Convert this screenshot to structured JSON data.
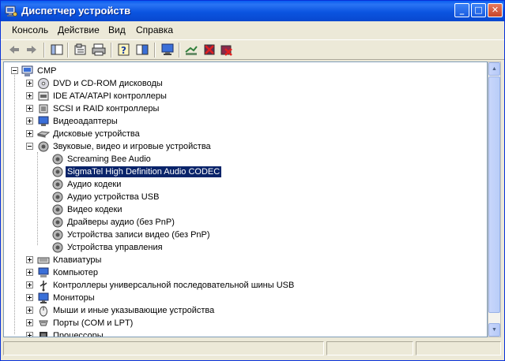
{
  "window": {
    "title": "Диспетчер устройств"
  },
  "titlebar": {
    "minimize_glyph": "_",
    "maximize_glyph": "□",
    "close_glyph": "✕"
  },
  "menu": [
    "Консоль",
    "Действие",
    "Вид",
    "Справка"
  ],
  "toolbar": {
    "icons": [
      "back-arrow-icon",
      "forward-arrow-icon",
      "console-tree-icon",
      "properties-icon",
      "print-icon",
      "help-icon",
      "show-hide-icon",
      "monitor-icon",
      "scan-hardware-icon",
      "disable-device-icon",
      "uninstall-device-icon"
    ]
  },
  "tree": {
    "root": "CMP",
    "categories": [
      {
        "label": "DVD и CD-ROM дисководы",
        "icon": "cdrom-icon",
        "expanded": false
      },
      {
        "label": "IDE ATA/ATAPI контроллеры",
        "icon": "ide-controller-icon",
        "expanded": false
      },
      {
        "label": "SCSI и RAID контроллеры",
        "icon": "scsi-controller-icon",
        "expanded": false
      },
      {
        "label": "Видеоадаптеры",
        "icon": "display-adapter-icon",
        "expanded": false
      },
      {
        "label": "Дисковые устройства",
        "icon": "disk-drive-icon",
        "expanded": false
      },
      {
        "label": "Звуковые, видео и игровые устройства",
        "icon": "sound-device-icon",
        "expanded": true,
        "children": [
          "Screaming Bee Audio",
          "SigmaTel High Definition Audio CODEC",
          "Аудио кодеки",
          "Аудио устройства USB",
          "Видео кодеки",
          "Драйверы аудио (без PnP)",
          "Устройства записи видео (без PnP)",
          "Устройства управления"
        ],
        "selected_child": 1
      },
      {
        "label": "Клавиатуры",
        "icon": "keyboard-icon",
        "expanded": false
      },
      {
        "label": "Компьютер",
        "icon": "computer-icon",
        "expanded": false
      },
      {
        "label": "Контроллеры универсальной последовательной шины USB",
        "icon": "usb-icon",
        "expanded": false
      },
      {
        "label": "Мониторы",
        "icon": "monitor-icon",
        "expanded": false
      },
      {
        "label": "Мыши и иные указывающие устройства",
        "icon": "mouse-icon",
        "expanded": false
      },
      {
        "label": "Порты (COM и LPT)",
        "icon": "port-icon",
        "expanded": false
      },
      {
        "label": "Процессоры",
        "icon": "processor-icon",
        "expanded": false
      }
    ]
  },
  "colors": {
    "titlebar": "#0a5ef0",
    "selection": "#0a246a",
    "chrome": "#ece9d8"
  }
}
